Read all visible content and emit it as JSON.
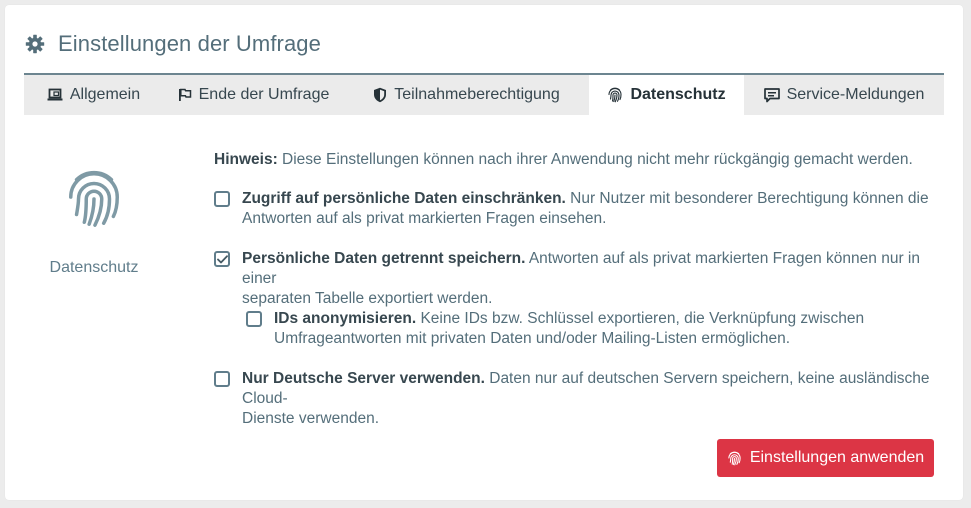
{
  "panel": {
    "title": "Einstellungen der Umfrage",
    "title_icon": "gear-icon"
  },
  "tabs": [
    {
      "label": "Allgemein",
      "icon": "laptop-icon",
      "active": false
    },
    {
      "label": "Ende der Umfrage",
      "icon": "flag-icon",
      "active": false
    },
    {
      "label": "Teilnahmeberechtigung",
      "icon": "shield-icon",
      "active": false
    },
    {
      "label": "Datenschutz",
      "icon": "fingerprint-icon",
      "active": true
    },
    {
      "label": "Service-Meldungen",
      "icon": "message-icon",
      "active": false
    }
  ],
  "side": {
    "label": "Datenschutz",
    "icon": "fingerprint-icon"
  },
  "hint": {
    "label": "Hinweis:",
    "text": " Diese Einstellungen können nach ihrer Anwendung nicht mehr rückgängig gemacht werden."
  },
  "options": [
    {
      "title": "Zugriff auf persönliche Daten einschränken.",
      "line1": " Nur Nutzer mit besonderer Berechtigung können die",
      "line2": "Antworten auf als privat markierten Fragen einsehen.",
      "checked": false
    },
    {
      "title": "Persönliche Daten getrennt speichern.",
      "line1": " Antworten auf als privat markierten Fragen können nur in einer",
      "line2": "separaten Tabelle exportiert werden.",
      "checked": true
    },
    {
      "title": "IDs anonymisieren.",
      "line1": " Keine IDs bzw. Schlüssel exportieren, die Verknüpfung zwischen",
      "line2": "Umfrageantworten mit privaten Daten und/oder Mailing-Listen ermöglichen.",
      "checked": false
    },
    {
      "title": "Nur Deutsche Server verwenden.",
      "line1": " Daten nur auf deutschen Servern speichern, keine ausländische Cloud-",
      "line2": "Dienste verwenden.",
      "checked": false
    }
  ],
  "apply_button": {
    "label": "Einstellungen anwenden",
    "icon": "fingerprint-icon"
  },
  "colors": {
    "accent": "#dc3545",
    "text": "#546e7a",
    "tab_border": "#6c8590"
  }
}
